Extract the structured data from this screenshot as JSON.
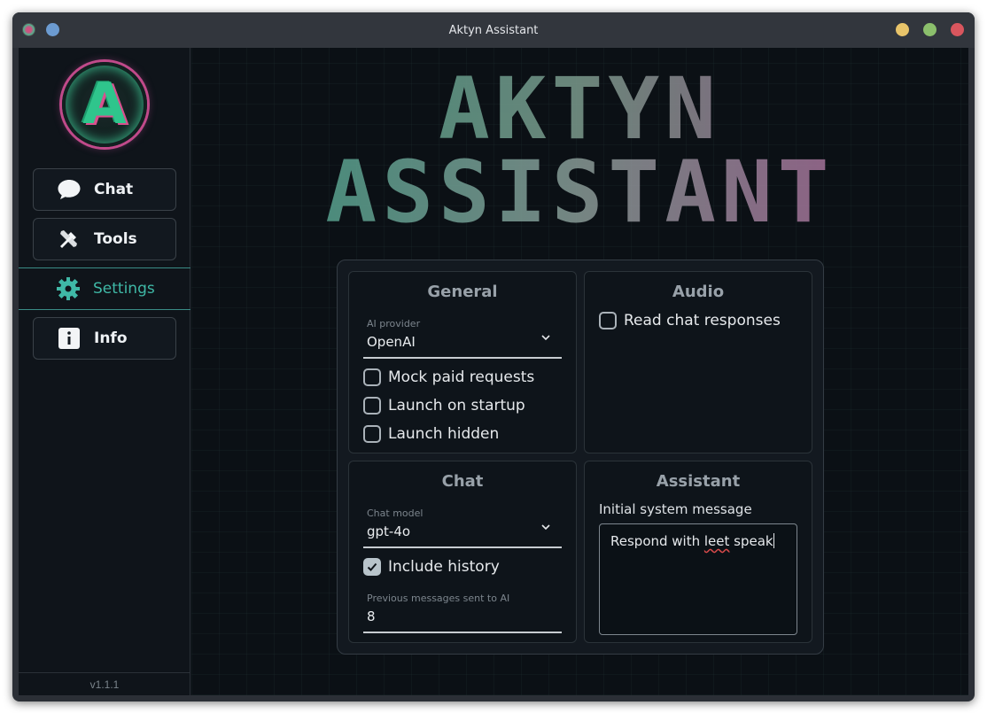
{
  "window": {
    "title": "Aktyn Assistant"
  },
  "sidebar": {
    "logo_letter": "A",
    "items": [
      {
        "label": "Chat",
        "icon": "chat-bubble-icon"
      },
      {
        "label": "Tools",
        "icon": "tools-icon"
      },
      {
        "label": "Settings",
        "icon": "gear-icon",
        "active": true
      },
      {
        "label": "Info",
        "icon": "info-icon"
      }
    ],
    "version": "v1.1.1"
  },
  "banner": {
    "line1": "AKTYN",
    "line2": "ASSISTANT"
  },
  "settings": {
    "general": {
      "title": "General",
      "provider_label": "AI provider",
      "provider_value": "OpenAI",
      "mock_paid_requests": {
        "label": "Mock paid requests",
        "checked": false
      },
      "launch_on_startup": {
        "label": "Launch on startup",
        "checked": false
      },
      "launch_hidden": {
        "label": "Launch hidden",
        "checked": false
      }
    },
    "audio": {
      "title": "Audio",
      "read_chat_responses": {
        "label": "Read chat responses",
        "checked": false
      }
    },
    "chat": {
      "title": "Chat",
      "model_label": "Chat model",
      "model_value": "gpt-4o",
      "include_history": {
        "label": "Include history",
        "checked": true
      },
      "previous_messages_label": "Previous messages sent to AI",
      "previous_messages_value": "8"
    },
    "assistant": {
      "title": "Assistant",
      "system_message_label": "Initial system message",
      "system_message_before": "Respond with ",
      "system_message_misspelled": "leet",
      "system_message_after": " speak"
    }
  },
  "colors": {
    "accent": "#3fb8a6",
    "background": "#0c1016",
    "card": "#0e141a"
  }
}
